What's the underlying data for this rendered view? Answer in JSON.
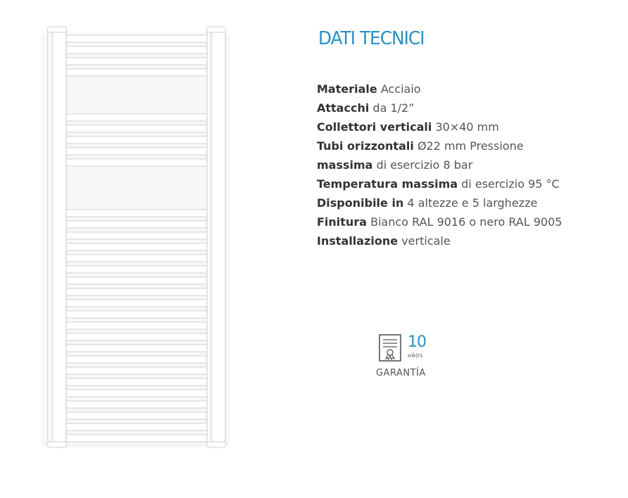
{
  "product_image": {
    "icon": "towel-radiator-image",
    "finish_color": "#ffffff"
  },
  "title": "DATI TECNICI",
  "specs": [
    {
      "key": "Materiale",
      "value": "Acciaio"
    },
    {
      "key": "Attacchi",
      "value": "da 1/2”"
    },
    {
      "key": "Collettori verticali",
      "value": "30×40 mm"
    },
    {
      "key": "Tubi orizzontali",
      "value": "Ø22 mm Pressione"
    },
    {
      "key": "massima",
      "value": "di esercizio 8 bar"
    },
    {
      "key": "Temperatura massima",
      "value": "di esercizio 95 °C"
    },
    {
      "key": "Disponibile in",
      "value": "4 altezze e 5 larghezze"
    },
    {
      "key": "Finitura",
      "value": "Bianco RAL 9016 o nero RAL 9005"
    },
    {
      "key": "Installazione",
      "value": "verticale"
    }
  ],
  "warranty": {
    "icon": "warranty-certificate-icon",
    "years": "10",
    "unit": "AÑOS",
    "label": "GARANTÍA"
  },
  "colors": {
    "accent": "#2a8fc4",
    "text": "#555555",
    "text_strong": "#333333"
  }
}
